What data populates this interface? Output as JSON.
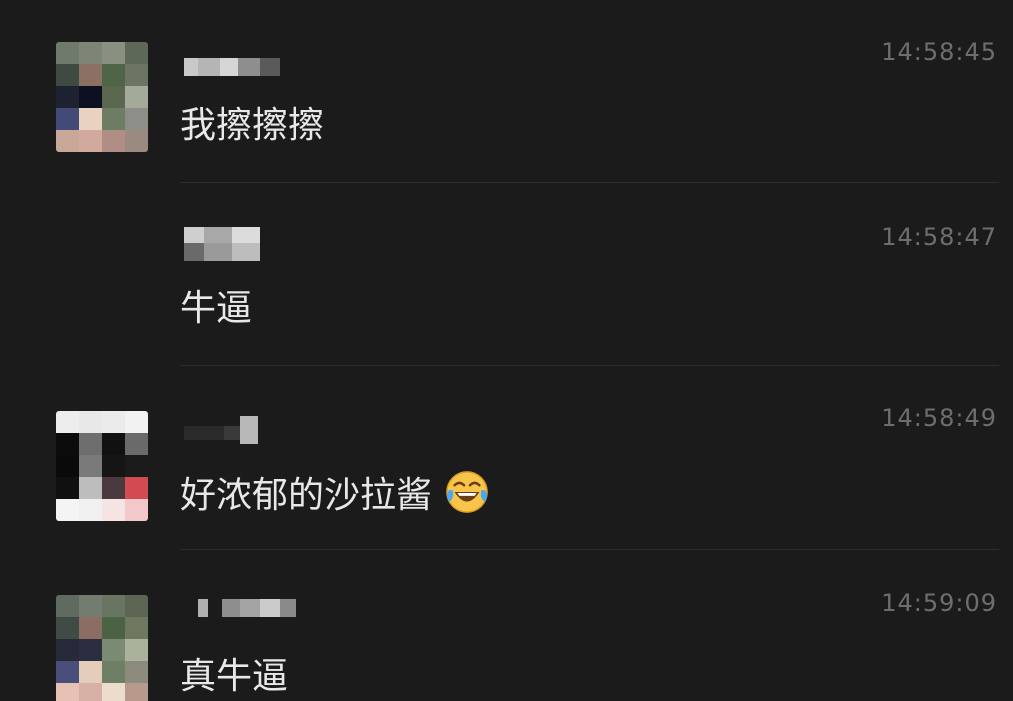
{
  "messages": [
    {
      "time": "14:58:45",
      "text": "我擦擦擦",
      "avatar": "pixelated-avatar",
      "sender": "redacted"
    },
    {
      "time": "14:58:47",
      "text": "牛逼",
      "avatar": "none",
      "sender": "redacted"
    },
    {
      "time": "14:58:49",
      "text": "好浓郁的沙拉酱",
      "emoji": "tears-of-joy-emoji",
      "avatar": "pixelated-avatar",
      "sender": "redacted"
    },
    {
      "time": "14:59:09",
      "text": "真牛逼",
      "avatar": "pixelated-avatar",
      "sender": "redacted"
    }
  ],
  "colors": {
    "background": "#1b1b1c",
    "message_text": "#e8e8e8",
    "timestamp": "#6e6e70",
    "divider": "#2c2c2e"
  }
}
